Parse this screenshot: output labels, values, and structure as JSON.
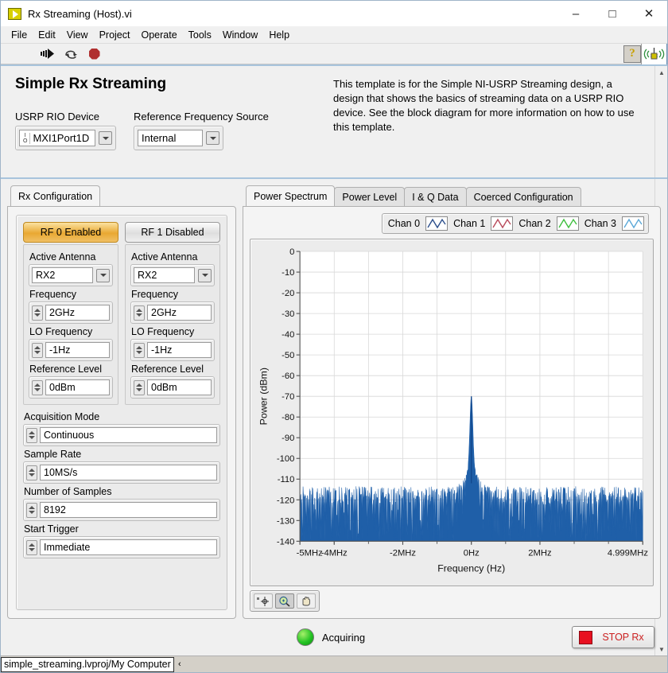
{
  "window": {
    "title": "Rx Streaming (Host).vi",
    "icon": "labview-vi-icon",
    "minimize": "–",
    "maximize": "□",
    "close": "✕"
  },
  "menubar": {
    "items": [
      "File",
      "Edit",
      "View",
      "Project",
      "Operate",
      "Tools",
      "Window",
      "Help"
    ]
  },
  "toolbar": {
    "run_icon": "run-arrow-icon",
    "run_continuous_icon": "run-continuously-icon",
    "abort_icon": "abort-execution-icon",
    "help_icon": "context-help-icon",
    "help_label": "?",
    "vi_icon": "usrp-antenna-vi-icon"
  },
  "header": {
    "title": "Simple Rx Streaming",
    "description": "This template is for the Simple NI-USRP Streaming design, a design that shows the basics of streaming data on a USRP RIO device. See the block diagram for more information on how to use this template.",
    "device": {
      "label": "USRP RIO Device",
      "value": "MXI1Port1D",
      "io_glyph_top": "I",
      "io_glyph_bottom": "O"
    },
    "ref_source": {
      "label": "Reference Frequency Source",
      "value": "Internal"
    }
  },
  "config": {
    "tab_label": "Rx Configuration",
    "channels": [
      {
        "toggle_label": "RF 0 Enabled",
        "enabled": true,
        "antenna_label": "Active Antenna",
        "antenna_value": "RX2",
        "frequency_label": "Frequency",
        "frequency_value": "2GHz",
        "lo_label": "LO Frequency",
        "lo_value": "-1Hz",
        "reflevel_label": "Reference Level",
        "reflevel_value": "0dBm"
      },
      {
        "toggle_label": "RF 1 Disabled",
        "enabled": false,
        "antenna_label": "Active Antenna",
        "antenna_value": "RX2",
        "frequency_label": "Frequency",
        "frequency_value": "2GHz",
        "lo_label": "LO Frequency",
        "lo_value": "-1Hz",
        "reflevel_label": "Reference Level",
        "reflevel_value": "0dBm"
      }
    ],
    "acquisition_mode": {
      "label": "Acquisition Mode",
      "value": "Continuous"
    },
    "sample_rate": {
      "label": "Sample Rate",
      "value": "10MS/s"
    },
    "num_samples": {
      "label": "Number of Samples",
      "value": "8192"
    },
    "start_trigger": {
      "label": "Start Trigger",
      "value": "Immediate"
    }
  },
  "graph_panel": {
    "tabs": [
      {
        "label": "Power Spectrum",
        "active": true
      },
      {
        "label": "Power Level",
        "active": false
      },
      {
        "label": "I & Q Data",
        "active": false
      },
      {
        "label": "Coerced Configuration",
        "active": false
      }
    ],
    "legend": [
      {
        "name": "Chan 0",
        "color": "#2c4f8c"
      },
      {
        "name": "Chan 1",
        "color": "#b84a5a"
      },
      {
        "name": "Chan 2",
        "color": "#3fbf3f"
      },
      {
        "name": "Chan 3",
        "color": "#5ba8d8"
      }
    ],
    "palette": [
      {
        "icon": "cursor-tool-icon",
        "selected": false
      },
      {
        "icon": "zoom-tool-icon",
        "selected": true
      },
      {
        "icon": "pan-hand-tool-icon",
        "selected": false
      }
    ]
  },
  "chart_data": {
    "type": "line",
    "title": "",
    "xlabel": "Frequency (Hz)",
    "ylabel": "Power (dBm)",
    "xlim": [
      -5000000,
      4999000
    ],
    "ylim": [
      -140,
      0
    ],
    "ytick_values": [
      0,
      -10,
      -20,
      -30,
      -40,
      -50,
      -60,
      -70,
      -80,
      -90,
      -100,
      -110,
      -120,
      -130,
      -140
    ],
    "ytick_labels": [
      "0",
      "-10",
      "-20",
      "-30",
      "-40",
      "-50",
      "-60",
      "-70",
      "-80",
      "-90",
      "-100",
      "-110",
      "-120",
      "-130",
      "-140"
    ],
    "xtick_values": [
      -5000000,
      -4000000,
      -2000000,
      0,
      2000000,
      4999000
    ],
    "xtick_labels": [
      "-5MHz",
      "-4MHz",
      "-2MHz",
      "0Hz",
      "2MHz",
      "4.999MHz"
    ],
    "grid": true,
    "legend_position": "top-right",
    "series": [
      {
        "name": "Chan 0",
        "color": "#1f5fa8",
        "noise_floor_dbm": -118,
        "noise_spread_db": 9,
        "noise_min_dbm": -140,
        "peak": {
          "x_hz": 0,
          "y_dbm": -70,
          "width_hz": 60000
        },
        "shoulder": {
          "y_dbm": -105,
          "width_hz": 260000
        },
        "description": "Dense noise floor near -118 dBm spanning the full span with a sharp carrier spike at 0 Hz reaching -70 dBm"
      }
    ]
  },
  "footer": {
    "status_text": "Acquiring",
    "led": "acquiring-led",
    "stop_button": "STOP Rx"
  },
  "statusbar": {
    "path": "simple_streaming.lvproj/My Computer",
    "arrow": "‹"
  }
}
